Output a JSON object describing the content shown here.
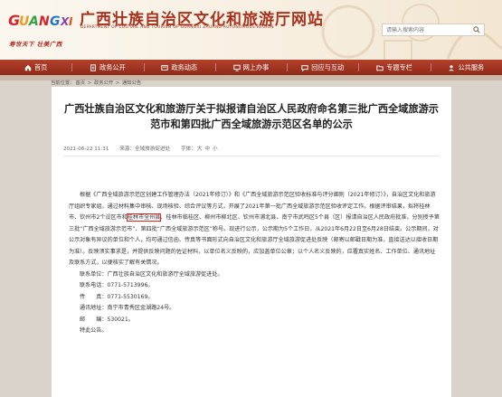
{
  "header": {
    "logo_text": "GUANGXI",
    "slogan": "寿世天下 壮美广西",
    "site_title": "广西壮族自治区文化和旅游厅网站",
    "site_subtitle": "DEPARTMENT OF CULTURE AND TOURISM OF GUANGXI ZHUANG AUTONOMOUS REGION",
    "search_placeholder": "请输入搜索内容"
  },
  "nav": {
    "items": [
      {
        "label": "首页",
        "icon": "home-icon"
      },
      {
        "label": "政务公开",
        "icon": "document-icon"
      },
      {
        "label": "政务动态",
        "icon": "news-icon"
      },
      {
        "label": "网上办事",
        "icon": "computer-icon"
      },
      {
        "label": "回应与互动",
        "icon": "chat-icon"
      },
      {
        "label": "专题专栏",
        "icon": "folder-icon"
      },
      {
        "label": "公共服务",
        "icon": "service-icon"
      }
    ]
  },
  "breadcrumb": {
    "prefix": "当前位置：",
    "items": [
      "首页",
      "政务公开",
      "通知公告"
    ],
    "separator": " > "
  },
  "article": {
    "title": "广西壮族自治区文化和旅游厅关于拟报请自治区人民政府命名第三批广西全域旅游示范市和第四批广西全域旅游示范区名单的公示",
    "date": "2021-06-22 11:31",
    "source": "来源：全域旅游促进处",
    "font_size_label": "字体：",
    "font_sizes": [
      "大",
      "中",
      "小"
    ],
    "paragraph_1_before": "根据《广西全域旅游示范区创建工作管理办法（2021年修订）》和《广西全域旅游示范区验收标准与评分细则（2021年修订）》，自治区文化和旅游厅组织专家组，通过材料集中审核、现场核验、综合评议等方式，开展了2021年第一批广西全域旅游示范区验收评定工作。根据评审结果，拟将桂林市、钦州市2个设区市和",
    "highlight": "桂林市全州县",
    "paragraph_1_after": "、桂林市临桂区、柳州市柳北区、钦州市浦北县、南宁市武鸣区5个县（区）报请自治区人民政府批准，分别授予第三批“广西全域旅游示范市”、第四批“广西全域旅游示范区”称号。现进行公示，公示期为5个工作日，从2021年6月22日至6月28日结束。公示期间，对公示对象有异议的单位和个人，均可通过信函、传真等书面形式向自治区文化和旅游厅全域旅游促进处反映（邮寄以邮戳日期为准，直接送达以接收日期为准）。反映须实事求是，并提供反映问题的佐证材料，以单位名义反映的，应加盖单位公章；以个人名义反映的，应署真实姓名、工作单位、通讯地址及联系方式，以便核实了解有关情况。",
    "contact_unit": "联系单位：广西壮族自治区文化和旅游厅全域旅游促进处。",
    "phone": "联系电话：0771-5713996。",
    "fax": "传　　真：0771-5530169。",
    "address": "通讯地址：南宁市青秀区金湖路24号。",
    "postcode": "邮　　编：530021。",
    "closing": "特此公告。"
  },
  "colors": {
    "nav_red": "#a0351f",
    "title_red": "#a8321d",
    "highlight_box": "#e21e1e"
  }
}
